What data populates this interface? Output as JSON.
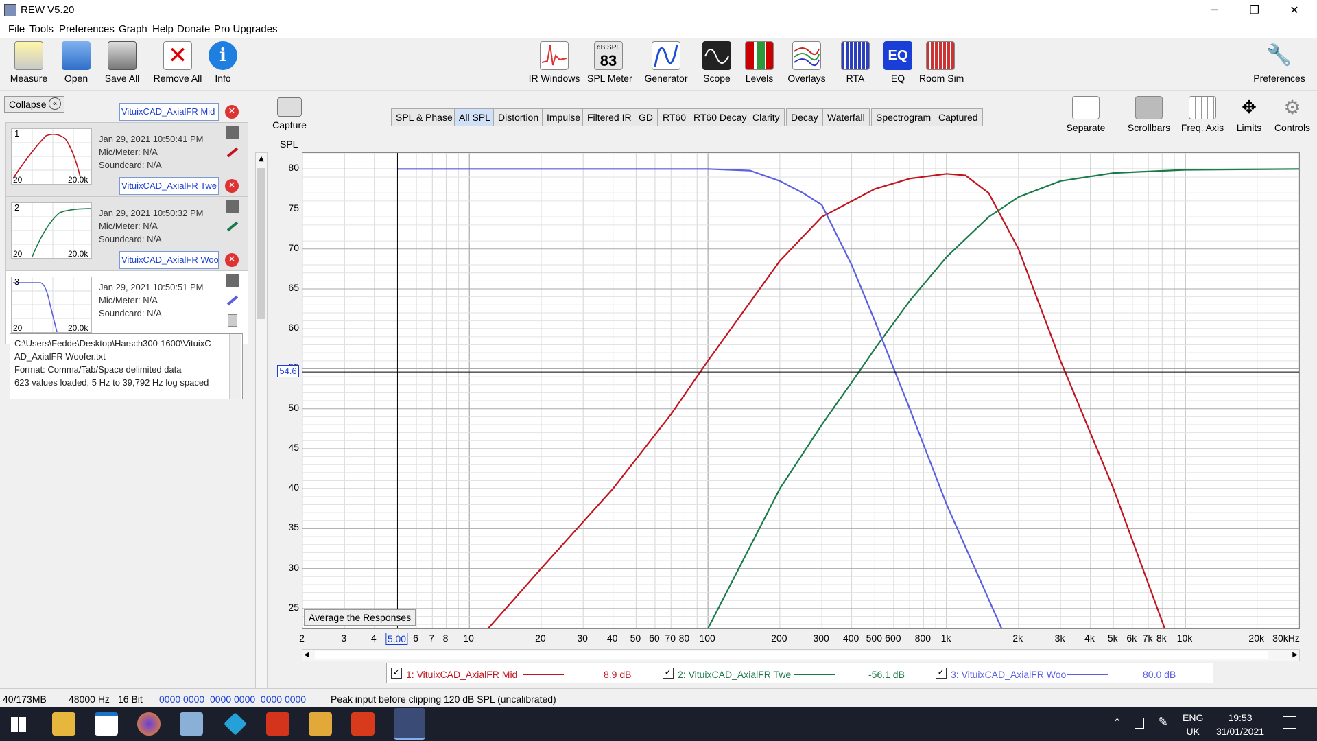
{
  "window": {
    "title": "REW V5.20",
    "minimize": "─",
    "restore": "❐",
    "close": "✕"
  },
  "menu": [
    "File",
    "Tools",
    "Preferences",
    "Graph",
    "Help",
    "Donate",
    "Pro Upgrades"
  ],
  "toolbar_left": [
    "Measure",
    "Open",
    "Save All",
    "Remove All",
    "Info"
  ],
  "toolbar_mid": [
    "IR Windows",
    "SPL Meter",
    "Generator",
    "Scope",
    "Levels",
    "Overlays",
    "RTA",
    "EQ",
    "Room Sim"
  ],
  "spl_meter_value": "83",
  "spl_meter_unit": "dB SPL",
  "toolbar_right": "Preferences",
  "capture": "Capture",
  "graph_tools": [
    "Separate",
    "Scrollbars",
    "Freq. Axis",
    "Limits",
    "Controls"
  ],
  "collapse": "Collapse",
  "measurements": [
    {
      "num": "1",
      "name": "VituixCAD_AxialFR Mid",
      "date": "Jan 29, 2021 10:50:41 PM",
      "mic": "Mic/Meter: N/A",
      "soundcard": "Soundcard: N/A",
      "color": "#c0151f",
      "tmin": "20",
      "tmax": "20.0k"
    },
    {
      "num": "2",
      "name": "VituixCAD_AxialFR Twe",
      "date": "Jan 29, 2021 10:50:32 PM",
      "mic": "Mic/Meter: N/A",
      "soundcard": "Soundcard: N/A",
      "color": "#1a7a4a",
      "tmin": "20",
      "tmax": "20.0k"
    },
    {
      "num": "3",
      "name": "VituixCAD_AxialFR Woo",
      "date": "Jan 29, 2021 10:50:51 PM",
      "mic": "Mic/Meter: N/A",
      "soundcard": "Soundcard: N/A",
      "color": "#5b5fe0",
      "tmin": "20",
      "tmax": "20.0k"
    }
  ],
  "notes": [
    "C:\\Users\\Fedde\\Desktop\\Harsch300-1600\\VituixC",
    "AD_AxialFR Woofer.txt",
    "Format: Comma/Tab/Space delimited data",
    "623 values loaded, 5 Hz to 39,792 Hz log spaced"
  ],
  "graph_tabs": [
    "SPL & Phase",
    "All SPL",
    "Distortion",
    "Impulse",
    "Filtered IR",
    "GD",
    "RT60",
    "RT60 Decay",
    "Clarity",
    "Decay",
    "Waterfall",
    "Spectrogram",
    "Captured"
  ],
  "active_tab": "All SPL",
  "average_button": "Average the Responses",
  "legend": [
    {
      "label": "1: VituixCAD_AxialFR Mid",
      "value": "8.9 dB",
      "color": "#c0151f"
    },
    {
      "label": "2: VituixCAD_AxialFR Twe",
      "value": "-56.1 dB",
      "color": "#1a7a4a"
    },
    {
      "label": "3: VituixCAD_AxialFR Woo",
      "value": "80.0 dB",
      "color": "#5b5fe0"
    }
  ],
  "status": {
    "memory": "40/173MB",
    "rate": "48000 Hz",
    "bits": "16 Bit",
    "levels": "0000 0000  0000 0000  0000 0000",
    "message": "Peak input before clipping 120 dB SPL (uncalibrated)"
  },
  "tray": {
    "lang1": "ENG",
    "lang2": "UK",
    "time": "19:53",
    "date": "31/01/2021"
  },
  "chart_data": {
    "type": "line",
    "ylabel": "SPL",
    "ylim": [
      22.5,
      82
    ],
    "xlim": [
      2,
      30000
    ],
    "x_scale": "log",
    "yticks": [
      "80",
      "75",
      "70",
      "65",
      "60",
      "55",
      "50",
      "45",
      "40",
      "35",
      "30",
      "25"
    ],
    "xticks": [
      "2",
      "3",
      "4",
      "5.00",
      "6",
      "7",
      "8",
      "10",
      "20",
      "30",
      "40",
      "50",
      "60",
      "70",
      "80",
      "100",
      "200",
      "300",
      "400",
      "500",
      "600",
      "800",
      "1k",
      "2k",
      "3k",
      "4k",
      "5k",
      "6k",
      "7k",
      "8k",
      "10k",
      "20k",
      "30kHz"
    ],
    "cursor": {
      "x": 5,
      "y": 54.6,
      "y_label": "54.6",
      "x_label": "5.00"
    },
    "series": [
      {
        "name": "1: VituixCAD_AxialFR Mid",
        "color": "#c0151f",
        "x": [
          12,
          20,
          40,
          70,
          100,
          200,
          300,
          500,
          700,
          1000,
          1200,
          1500,
          2000,
          3000,
          5000,
          8200
        ],
        "y": [
          22.5,
          30,
          40,
          49.3,
          56,
          68.5,
          74,
          77.5,
          78.8,
          79.4,
          79.2,
          77,
          70,
          56,
          40,
          22.5
        ]
      },
      {
        "name": "2: VituixCAD_AxialFR Twe",
        "color": "#1a7a4a",
        "x": [
          100,
          200,
          300,
          400,
          500,
          700,
          1000,
          1500,
          2000,
          3000,
          5000,
          10000,
          30000
        ],
        "y": [
          22.5,
          40,
          48,
          53.3,
          57.5,
          63.5,
          69,
          74,
          76.5,
          78.5,
          79.5,
          79.9,
          80
        ]
      },
      {
        "name": "3: VituixCAD_AxialFR Woo",
        "color": "#5b5fe0",
        "x": [
          5,
          50,
          100,
          150,
          200,
          250,
          300,
          400,
          500,
          700,
          1000,
          1700
        ],
        "y": [
          80,
          80,
          80,
          79.8,
          78.5,
          77,
          75.5,
          68,
          61,
          50,
          38,
          22.5
        ]
      }
    ]
  }
}
